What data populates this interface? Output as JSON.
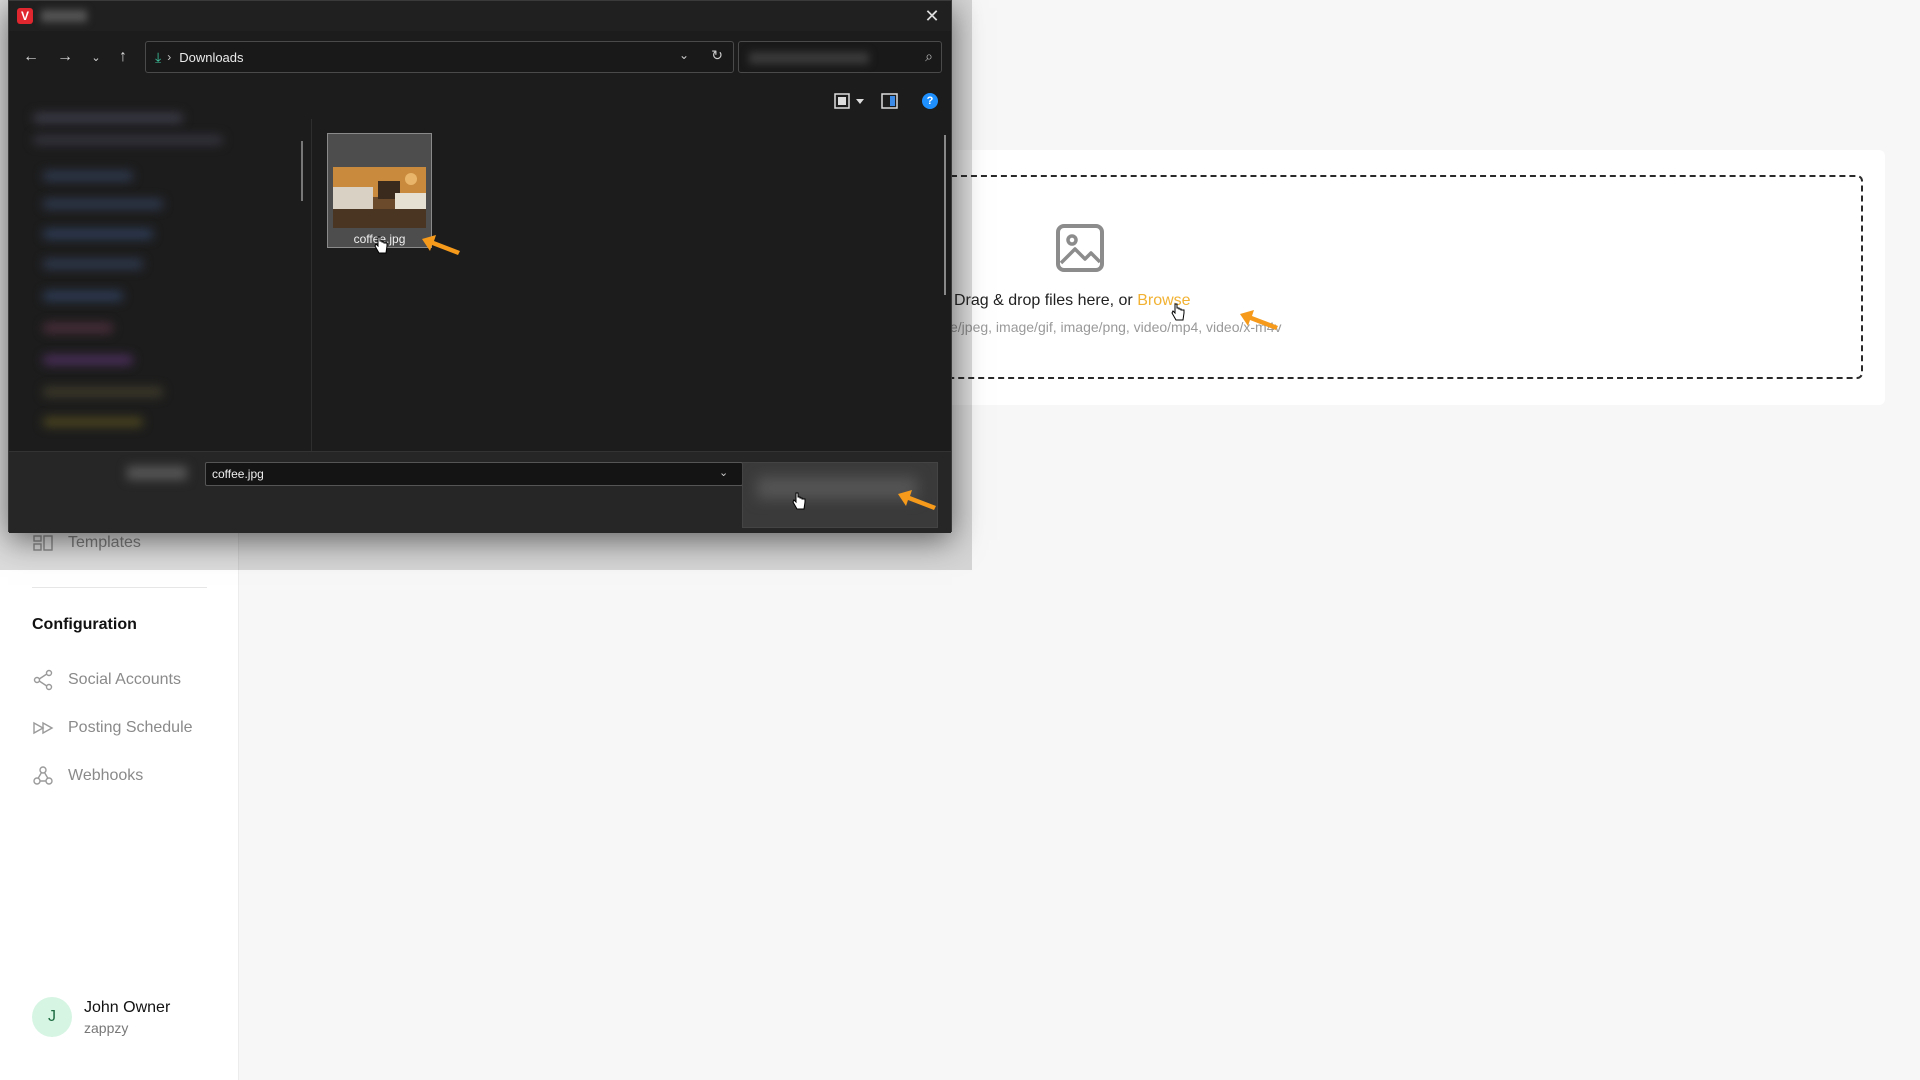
{
  "sidebar": {
    "items": [
      {
        "label": "Templates",
        "icon": "templates-icon"
      },
      {
        "label": "Social Accounts",
        "icon": "share-icon"
      },
      {
        "label": "Posting Schedule",
        "icon": "fast-forward-icon"
      },
      {
        "label": "Webhooks",
        "icon": "webhook-icon"
      }
    ],
    "section_title": "Configuration",
    "user": {
      "initial": "J",
      "name": "John Owner",
      "subtitle": "zappzy"
    }
  },
  "upload": {
    "drop_text": "Drag & drop files here, or ",
    "browse_label": "Browse",
    "accepted_types": "e/jpeg, image/gif, image/png, video/mp4, video/x-m4v"
  },
  "dialog": {
    "app_logo": "V",
    "close_glyph": "✕",
    "address": {
      "folder": "Downloads"
    },
    "files": [
      {
        "name": "coffee.jpg"
      }
    ],
    "filename_value": "coffee.jpg",
    "help_glyph": "?"
  },
  "colors": {
    "accent_browse": "#f2b233",
    "annotation_arrow": "#f59a1b",
    "dialog_bg": "#1c1c1c"
  }
}
